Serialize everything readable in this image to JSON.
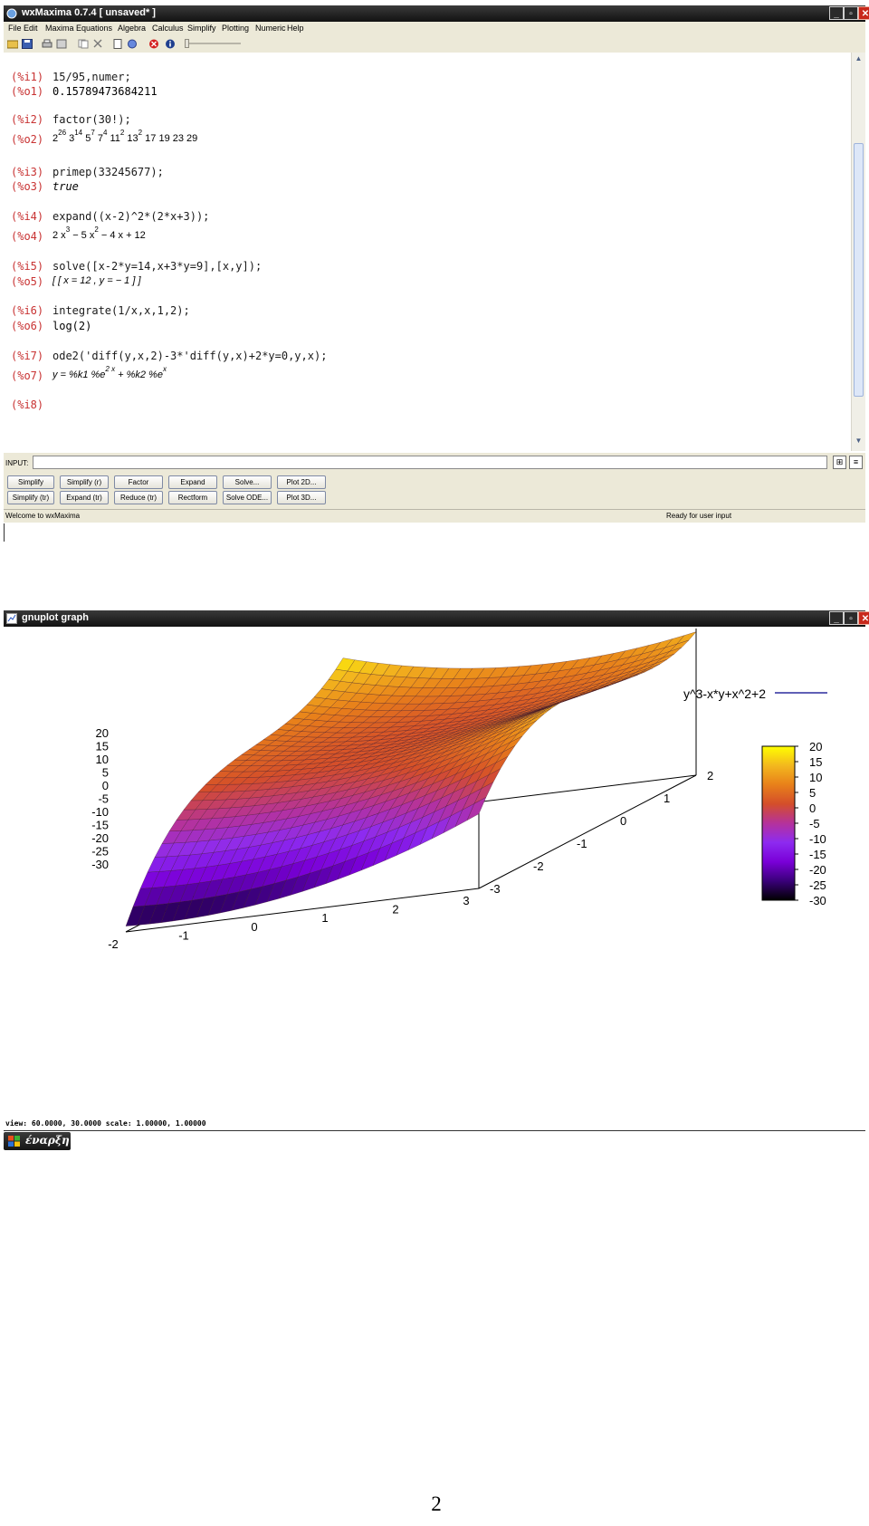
{
  "wxmaxima": {
    "title": "wxMaxima 0.7.4 [ unsaved* ]",
    "menu": [
      "File",
      "Edit",
      "Maxima",
      "Equations",
      "Algebra",
      "Calculus",
      "Simplify",
      "Plotting",
      "Numeric",
      "Help"
    ],
    "cells": [
      {
        "in_label": "(%i1)",
        "input": "15/95,numer;",
        "out_label": "(%o1)",
        "output": "0.15789473684211"
      },
      {
        "in_label": "(%i2)",
        "input": "factor(30!);",
        "out_label": "(%o2)"
      },
      {
        "in_label": "(%i3)",
        "input": "primep(33245677);",
        "out_label": "(%o3)",
        "output": "true"
      },
      {
        "in_label": "(%i4)",
        "input": "expand((x-2)^2*(2*x+3));",
        "out_label": "(%o4)"
      },
      {
        "in_label": "(%i5)",
        "input": "solve([x-2*y=14,x+3*y=9],[x,y]);",
        "out_label": "(%o5)",
        "output": "[ [ x = 12 , y = − 1 ] ]"
      },
      {
        "in_label": "(%i6)",
        "input": "integrate(1/x,x,1,2);",
        "out_label": "(%o6)",
        "output": "log(2)"
      },
      {
        "in_label": "(%i7)",
        "input": "ode2('diff(y,x,2)-3*'diff(y,x)+2*y=0,y,x);",
        "out_label": "(%o7)"
      },
      {
        "in_label": "(%i8)"
      }
    ],
    "o2": {
      "b1": "2",
      "e1": "26",
      "b2": "3",
      "e2": "14",
      "b3": "5",
      "e3": "7",
      "b4": "7",
      "e4": "4",
      "b5": "11",
      "e5": "2",
      "b6": "13",
      "e6": "2",
      "rest": "17 19 23 29"
    },
    "o4": {
      "t1": "2 x",
      "e1": "3",
      "t2": " − 5 x",
      "e2": "2",
      "t3": " − 4 x + 12"
    },
    "o7": {
      "t1": "y = %k1 %e",
      "e1": "2 x",
      "t2": " + %k2 %e",
      "e2": "x"
    },
    "input_label": "INPUT:",
    "input_value": "",
    "buttons_row1": [
      "Simplify",
      "Simplify (r)",
      "Factor",
      "Expand",
      "Solve...",
      "Plot 2D..."
    ],
    "buttons_row2": [
      "Simplify (tr)",
      "Expand (tr)",
      "Reduce (tr)",
      "Rectform",
      "Solve ODE...",
      "Plot 3D..."
    ],
    "status_left": "Welcome to wxMaxima",
    "status_right": "Ready for user input"
  },
  "gnuplot": {
    "title": "gnuplot graph",
    "status": "view: 60.0000, 30.0000   scale: 1.00000, 1.00000"
  },
  "taskbar": {
    "start_label": "έναρξη"
  },
  "page_number": "2",
  "chart_data": {
    "type": "surface",
    "legend": "y^3-x*y+x^2+2",
    "legend_color": "#00008b",
    "x_ticks": [
      "-2",
      "-1",
      "0",
      "1",
      "2",
      "3"
    ],
    "y_ticks": [
      "-3",
      "-2",
      "-1",
      "0",
      "1",
      "2"
    ],
    "z_ticks": [
      "20",
      "15",
      "10",
      "5",
      "0",
      "-5",
      "-10",
      "-15",
      "-20",
      "-25",
      "-30"
    ],
    "colorbar_ticks": [
      "20",
      "15",
      "10",
      "5",
      "0",
      "-5",
      "-10",
      "-15",
      "-20",
      "-25",
      "-30"
    ],
    "xlim": [
      -2,
      3
    ],
    "ylim": [
      -3,
      2
    ],
    "zlim": [
      -30,
      20
    ],
    "view": [
      60,
      30
    ],
    "palette": [
      "#000000",
      "#3a007a",
      "#7a00d8",
      "#8d2bf0",
      "#b5329b",
      "#d44e2a",
      "#e8801a",
      "#f3b81e",
      "#ffff00"
    ]
  }
}
